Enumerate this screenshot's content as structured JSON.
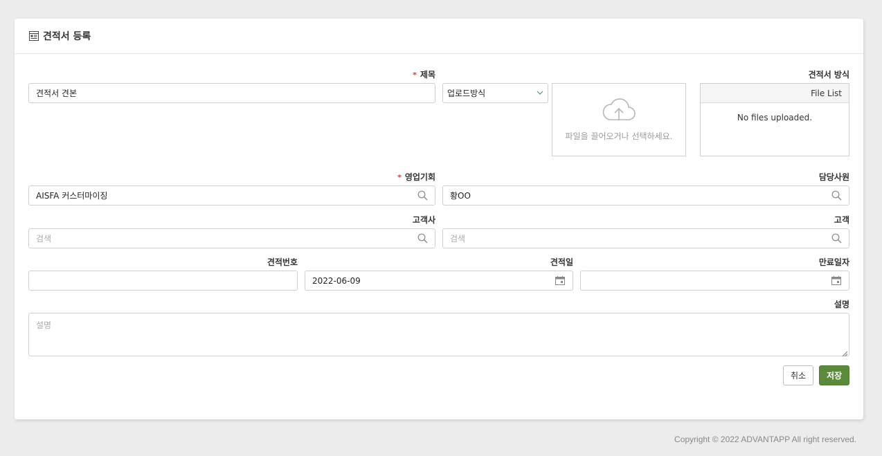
{
  "header": {
    "title": "견적서 등록",
    "icon": "form-icon"
  },
  "form": {
    "title": {
      "label": "제목",
      "required_mark": "*",
      "value": "견적서 견본"
    },
    "upload_method": {
      "selected": "업로드방식"
    },
    "quote_method": {
      "label": "견적서 방식"
    },
    "dropzone": {
      "text": "파일을 끌어오거나 선택하세요."
    },
    "file_list": {
      "header": "File List",
      "empty_text": "No files uploaded."
    },
    "opportunity": {
      "label": "영업기회",
      "required_mark": "*",
      "value": "AISFA 커스터마이징"
    },
    "assignee": {
      "label": "담당사원",
      "value": "황OO"
    },
    "customer_company": {
      "label": "고객사",
      "placeholder": "검색"
    },
    "customer": {
      "label": "고객",
      "placeholder": "검색"
    },
    "quote_number": {
      "label": "견적번호",
      "value": ""
    },
    "quote_date": {
      "label": "견적일",
      "value": "2022-06-09"
    },
    "expiry_date": {
      "label": "만료일자",
      "value": ""
    },
    "description": {
      "label": "설명",
      "placeholder": "설명"
    }
  },
  "buttons": {
    "cancel": "취소",
    "save": "저장"
  },
  "footer": {
    "copyright": "Copyright © 2022 ADVANTAPP All right reserved."
  },
  "colors": {
    "accent_green": "#5a8a3a",
    "required_red": "#e53935",
    "background": "#ececec"
  }
}
